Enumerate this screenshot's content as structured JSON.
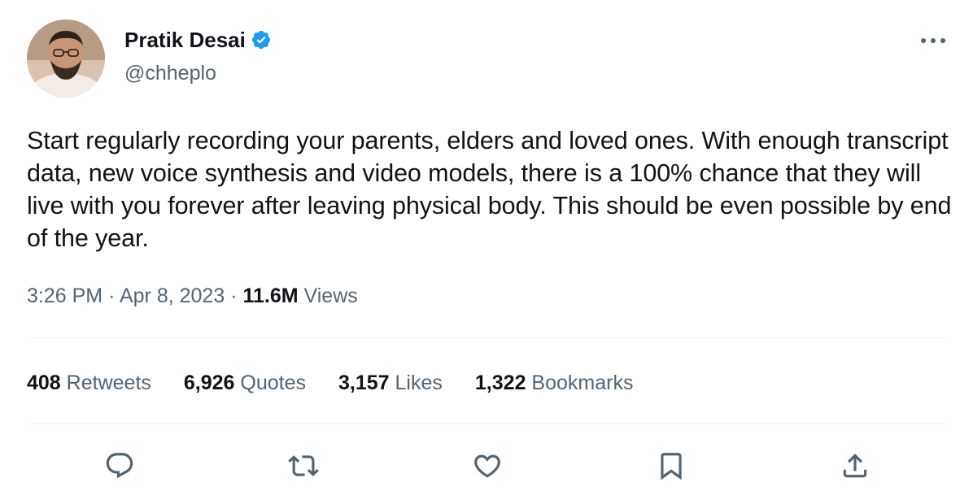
{
  "author": {
    "name": "Pratik Desai",
    "handle": "@chheplo",
    "verified": true
  },
  "tweet": {
    "text": "Start regularly recording your parents, elders and loved ones. With enough transcript data, new voice synthesis and video models, there is a 100% chance that they will live with you forever after leaving physical body. This should be even possible by end of the year.",
    "time": "3:26 PM",
    "separator": "·",
    "date": "Apr 8, 2023",
    "views_count": "11.6M",
    "views_label": "Views"
  },
  "stats": [
    {
      "count": "408",
      "label": "Retweets"
    },
    {
      "count": "6,926",
      "label": "Quotes"
    },
    {
      "count": "3,157",
      "label": "Likes"
    },
    {
      "count": "1,322",
      "label": "Bookmarks"
    }
  ],
  "actions": [
    {
      "name": "reply",
      "icon": "reply-icon"
    },
    {
      "name": "retweet",
      "icon": "retweet-icon"
    },
    {
      "name": "like",
      "icon": "heart-icon"
    },
    {
      "name": "bookmark",
      "icon": "bookmark-icon"
    },
    {
      "name": "share",
      "icon": "share-icon"
    }
  ],
  "colors": {
    "text": "#0f1419",
    "secondary": "#536471",
    "verified": "#1d9bf0",
    "divider": "#eff3f4"
  }
}
